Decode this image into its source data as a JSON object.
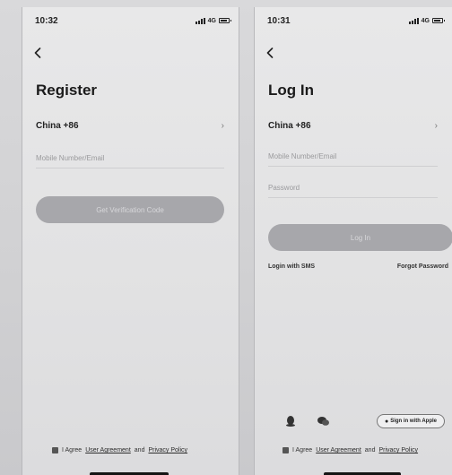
{
  "register_screen": {
    "status_time": "10:32",
    "network": "4G",
    "title": "Register",
    "country_code": "China +86",
    "account_placeholder": "Mobile Number/Email",
    "get_code_label": "Get Verification Code",
    "agreement": {
      "prefix": "I Agree",
      "user_agreement": "User Agreement",
      "and_text": "and",
      "privacy_policy": "Privacy Policy"
    }
  },
  "login_screen": {
    "status_time": "10:31",
    "network": "4G",
    "title": "Log In",
    "country_code": "China +86",
    "account_placeholder": "Mobile Number/Email",
    "password_placeholder": "Password",
    "login_label": "Log In",
    "sms_login_label": "Login with SMS",
    "forgot_password_label": "Forgot Password",
    "apple_sign_in_label": "Sign in with Apple",
    "agreement": {
      "prefix": "I Agree",
      "user_agreement": "User Agreement",
      "and_text": "and",
      "privacy_policy": "Privacy Policy"
    }
  },
  "icons": {
    "back": "back-icon",
    "chevron": "chevron-right-icon",
    "qq": "qq-icon",
    "wechat": "wechat-icon",
    "apple": "apple-icon"
  },
  "colors": {
    "button": "#a7a7ab",
    "background": "#e5e5e6",
    "text": "#222222"
  }
}
